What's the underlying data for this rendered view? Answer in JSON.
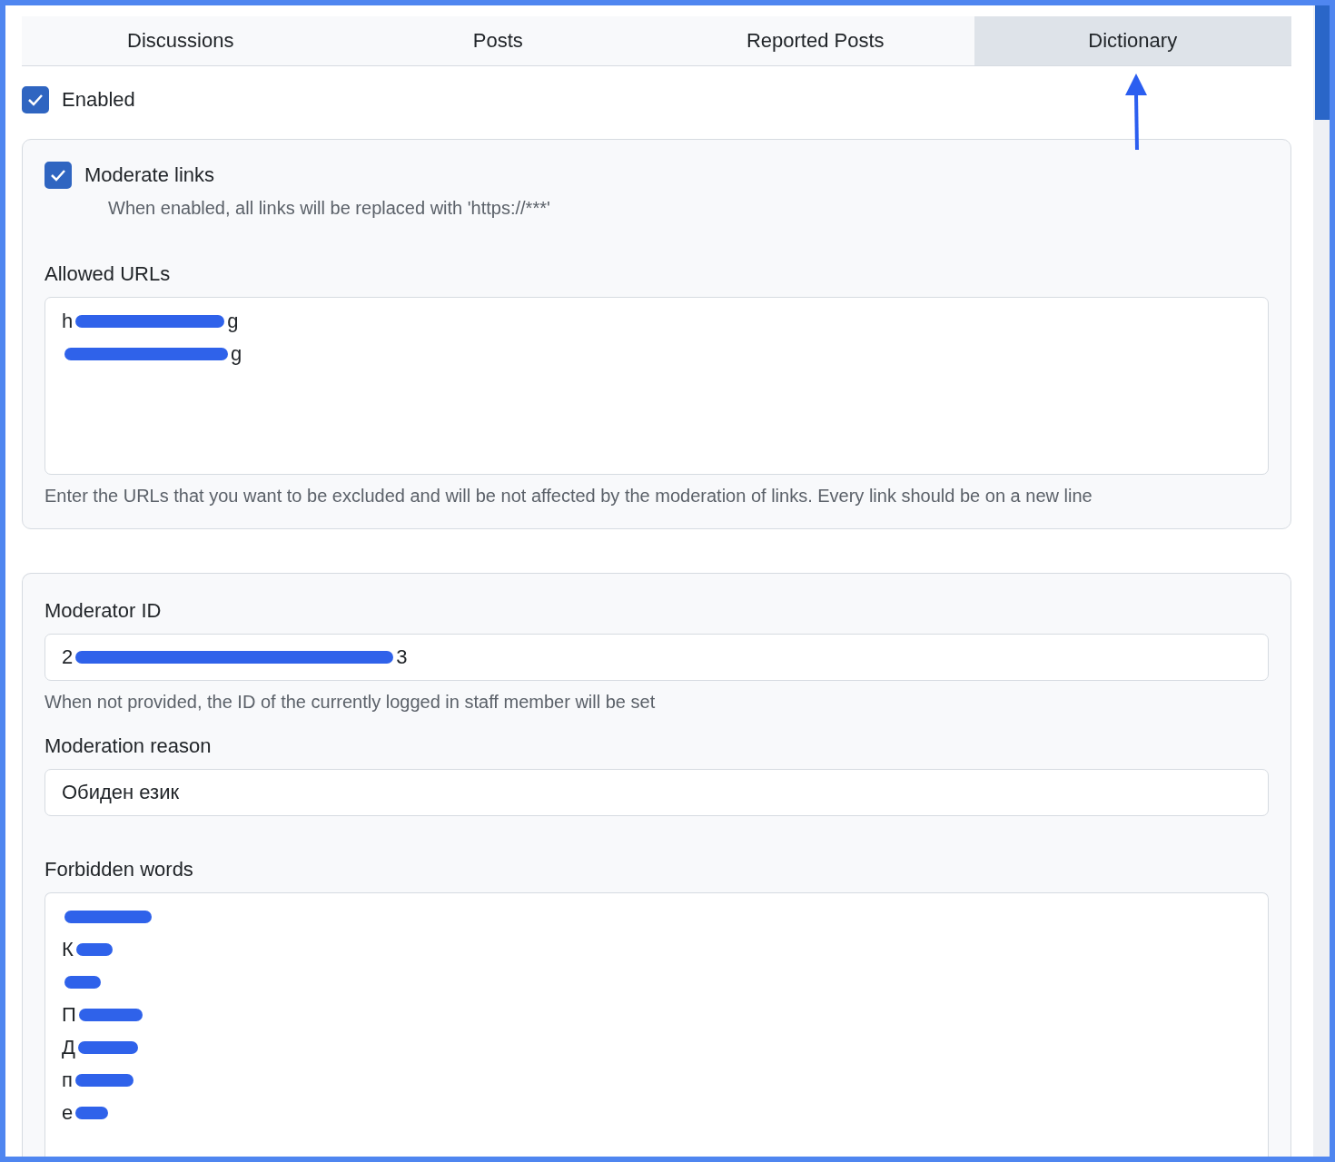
{
  "tabs": [
    {
      "label": "Discussions",
      "selected": false
    },
    {
      "label": "Posts",
      "selected": false
    },
    {
      "label": "Reported Posts",
      "selected": false
    },
    {
      "label": "Dictionary",
      "selected": true
    }
  ],
  "enabled": {
    "label": "Enabled",
    "checked": true
  },
  "links_panel": {
    "moderate_links": {
      "label": "Moderate links",
      "checked": true,
      "hint": "When enabled, all links will be replaced with 'https://***'"
    },
    "allowed_urls": {
      "label": "Allowed URLs",
      "lines": [
        {
          "start": "h",
          "redacted": true,
          "end": "g"
        },
        {
          "redacted": true,
          "end": "g"
        }
      ],
      "hint": "Enter the URLs that you want to be excluded and will be not affected by the moderation of links. Every link should be on a new line"
    }
  },
  "moderation_panel": {
    "moderator_id": {
      "label": "Moderator ID",
      "value": {
        "start": "2",
        "redacted": true,
        "end": "3"
      },
      "hint": "When not provided, the ID of the currently logged in staff member will be set"
    },
    "moderation_reason": {
      "label": "Moderation reason",
      "value": "Обиден език"
    },
    "forbidden_words": {
      "label": "Forbidden words",
      "lines": [
        {
          "redacted": true
        },
        {
          "start": "К",
          "redacted": true
        },
        {
          "redacted": true
        },
        {
          "start": "П",
          "redacted": true
        },
        {
          "start": "Д",
          "redacted": true
        },
        {
          "start": "п",
          "redacted": true
        },
        {
          "start": "е",
          "redacted": true
        }
      ]
    }
  }
}
